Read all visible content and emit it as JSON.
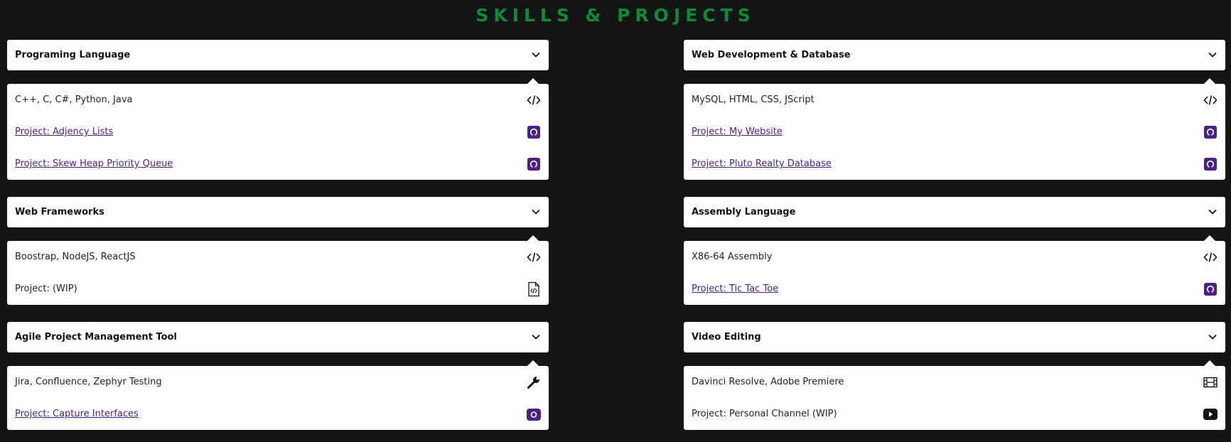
{
  "page": {
    "title": "SKILLS & PROJECTS",
    "accent_color": "#0f8b37",
    "link_color": "#4b2184"
  },
  "left": [
    {
      "header": "Programing Language",
      "skills": "C++, C, C#, Python, Java",
      "skills_icon": "code-icon",
      "projects": [
        {
          "label": "Project: Adjency Lists",
          "link": true,
          "icon": "github-icon"
        },
        {
          "label": "Project: Skew Heap Priority Queue",
          "link": true,
          "icon": "github-icon"
        }
      ]
    },
    {
      "header": "Web Frameworks",
      "skills": "Boostrap, NodeJS, ReactJS",
      "skills_icon": "code-icon",
      "projects": [
        {
          "label": "Project: (WIP)",
          "link": false,
          "icon": "file-code-icon"
        }
      ]
    },
    {
      "header": "Agile Project Management Tool",
      "skills": "Jira, Confluence, Zephyr Testing",
      "skills_icon": "wrench-icon",
      "projects": [
        {
          "label": "Project: Capture Interfaces",
          "link": true,
          "icon": "camera-icon"
        }
      ]
    }
  ],
  "right": [
    {
      "header": "Web Development & Database",
      "skills": "MySQL, HTML, CSS, JScript",
      "skills_icon": "code-icon",
      "projects": [
        {
          "label": "Project: My Website",
          "link": true,
          "icon": "github-icon"
        },
        {
          "label": "Project: Pluto Realty Database",
          "link": true,
          "icon": "github-icon"
        }
      ]
    },
    {
      "header": "Assembly Language",
      "skills": "X86-64 Assembly",
      "skills_icon": "code-icon",
      "projects": [
        {
          "label": "Project: Tic Tac Toe",
          "link": true,
          "icon": "github-icon"
        }
      ]
    },
    {
      "header": "Video Editing",
      "skills": "Davinci Resolve, Adobe Premiere",
      "skills_icon": "film-icon",
      "projects": [
        {
          "label": "Project: Personal Channel (WIP)",
          "link": false,
          "icon": "youtube-icon"
        }
      ]
    }
  ]
}
